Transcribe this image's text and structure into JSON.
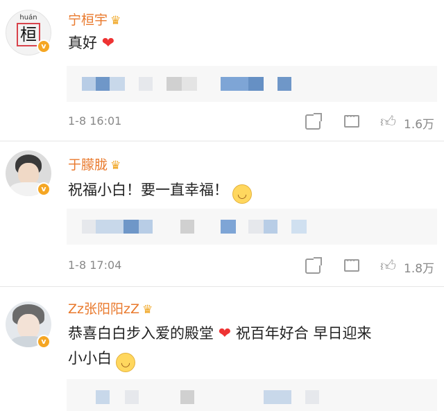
{
  "comments": [
    {
      "username": "宁桓宇",
      "avatar_pinyin": "huán",
      "avatar_char": "桓",
      "text": "真好",
      "time": "1-8 16:01",
      "likes": "1.6万"
    },
    {
      "username": "于朦胧",
      "text": "祝福小白！要一直幸福！",
      "time": "1-8 17:04",
      "likes": "1.8万"
    },
    {
      "username": "Zz张阳阳zZ",
      "text_line1": "恭喜白白步入爱的殿堂",
      "text_line1b": "祝百年好合 早日迎来",
      "text_line2": "小小白"
    }
  ],
  "colors": {
    "username": "#e9792c",
    "verified_badge": "#f5a623",
    "heart": "#e33333",
    "meta_text": "#888888",
    "reply_bg": "#f7f7f7"
  },
  "icons": [
    "crown-icon",
    "verified-badge-icon",
    "heart-emoji",
    "smile-emoji",
    "grin-emoji",
    "share-icon",
    "comment-icon",
    "like-icon"
  ]
}
